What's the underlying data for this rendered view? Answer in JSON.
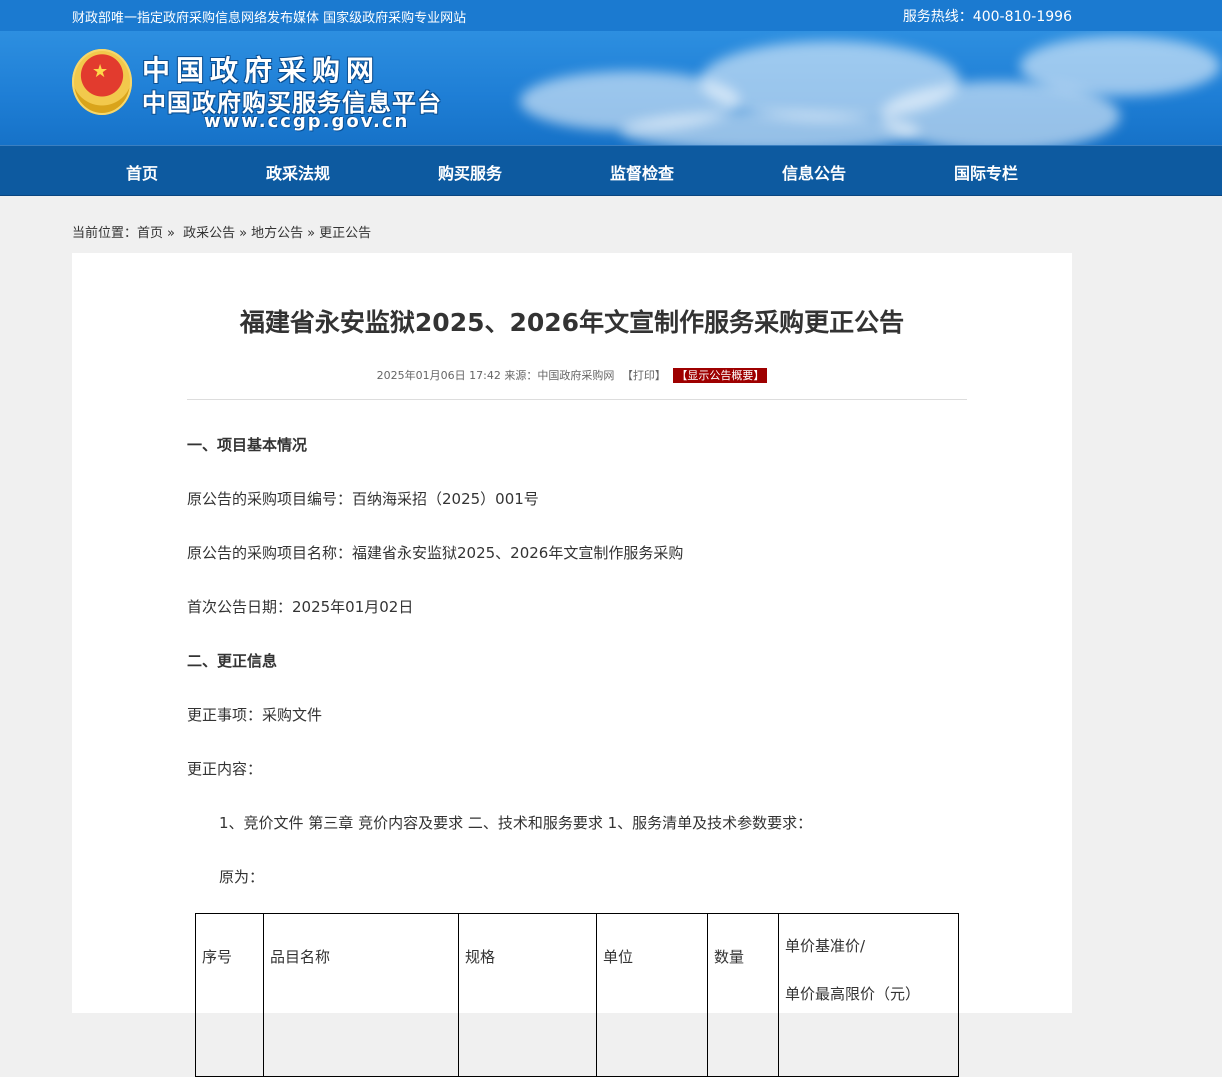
{
  "topbar": {
    "slogan": "财政部唯一指定政府采购信息网络发布媒体 国家级政府采购专业网站",
    "hotline": "服务热线：400-810-1996"
  },
  "logo": {
    "line1": "中国政府采购网",
    "line2": "中国政府购买服务信息平台",
    "url": "www.ccgp.gov.cn"
  },
  "nav": {
    "items": [
      "首页",
      "政采法规",
      "购买服务",
      "监督检查",
      "信息公告",
      "国际专栏"
    ]
  },
  "breadcrumb": {
    "label": "当前位置：",
    "items": [
      "首页",
      "政采公告",
      "地方公告",
      "更正公告"
    ],
    "separator": "»"
  },
  "article": {
    "title": "福建省永安监狱2025、2026年文宣制作服务采购更正公告",
    "meta_date_source": "2025年01月06日 17:42 来源：中国政府采购网",
    "meta_print": "【打印】",
    "meta_summary": "【显示公告概要】",
    "paragraphs": [
      "一、项目基本情况",
      "原公告的采购项目编号：百纳海采招（2025）001号",
      "原公告的采购项目名称：福建省永安监狱2025、2026年文宣制作服务采购",
      "首次公告日期：2025年01月02日",
      "二、更正信息",
      "更正事项：采购文件",
      "更正内容：",
      "1、竞价文件 第三章 竞价内容及要求 二、技术和服务要求 1、服务清单及技术参数要求：",
      "原为："
    ],
    "table": {
      "headers": [
        "序号",
        "品目名称",
        "规格",
        "单位",
        "数量"
      ],
      "price_header_line1": "单价基准价/",
      "price_header_line2": "单价最高限价（元）"
    }
  }
}
